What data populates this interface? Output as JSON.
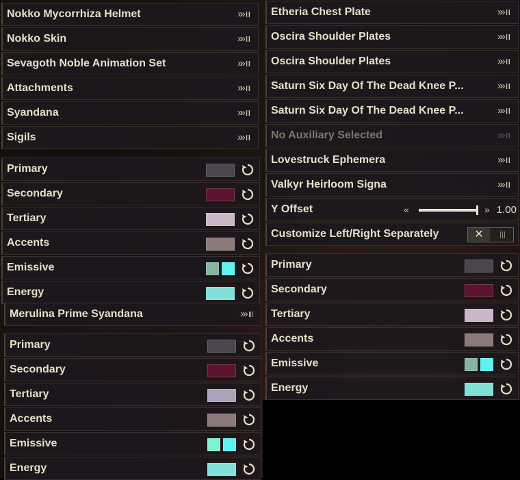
{
  "left": {
    "slots": [
      {
        "label": "Nokko Mycorrhiza Helmet",
        "icon": "chevron-double-right-icon"
      },
      {
        "label": "Nokko Skin",
        "icon": "chevron-double-right-icon"
      },
      {
        "label": "Sevagoth Noble Animation Set",
        "icon": "chevron-double-right-icon"
      },
      {
        "label": "Attachments",
        "icon": "chevron-double-right-icon"
      },
      {
        "label": "Syandana",
        "icon": "chevron-double-right-icon"
      },
      {
        "label": "Sigils",
        "icon": "chevron-double-right-icon"
      }
    ],
    "colors": [
      {
        "label": "Primary",
        "swatches": [
          "#4a4650"
        ]
      },
      {
        "label": "Secondary",
        "swatches": [
          "#5c1530"
        ]
      },
      {
        "label": "Tertiary",
        "swatches": [
          "#c9b6c7"
        ]
      },
      {
        "label": "Accents",
        "swatches": [
          "#8c7a7a"
        ]
      },
      {
        "label": "Emissive",
        "swatches": [
          "#86b5a2",
          "#5ff2f2"
        ]
      },
      {
        "label": "Energy",
        "swatches": [
          "#7fe0da"
        ]
      }
    ],
    "syandana": {
      "label": "Merulina Prime Syandana",
      "icon": "chevron-double-right-icon"
    },
    "syandana_colors": [
      {
        "label": "Primary",
        "swatches": [
          "#4a4650"
        ]
      },
      {
        "label": "Secondary",
        "swatches": [
          "#5c1530"
        ]
      },
      {
        "label": "Tertiary",
        "swatches": [
          "#a9a4ba"
        ]
      },
      {
        "label": "Accents",
        "swatches": [
          "#8c7a7a"
        ]
      },
      {
        "label": "Emissive",
        "swatches": [
          "#80f0d2",
          "#5ff2f2"
        ]
      },
      {
        "label": "Energy",
        "swatches": [
          "#7fe0da"
        ]
      }
    ]
  },
  "right": {
    "slots": [
      {
        "label": "Etheria Chest Plate",
        "disabled": false
      },
      {
        "label": "Oscira Shoulder Plates",
        "disabled": false
      },
      {
        "label": "Oscira Shoulder Plates",
        "disabled": false
      },
      {
        "label": "Saturn Six Day Of The Dead Knee P...",
        "disabled": false
      },
      {
        "label": "Saturn Six Day Of The Dead Knee P...",
        "disabled": false
      },
      {
        "label": "No Auxiliary Selected",
        "disabled": true
      },
      {
        "label": "Lovestruck Ephemera",
        "disabled": false
      },
      {
        "label": "Valkyr Heirloom Signa",
        "disabled": false
      }
    ],
    "y_offset": {
      "label": "Y Offset",
      "value": "1.00",
      "level": 1.0
    },
    "customize": {
      "label": "Customize Left/Right Separately",
      "state": "off"
    },
    "colors": [
      {
        "label": "Primary",
        "swatches": [
          "#4a4650"
        ]
      },
      {
        "label": "Secondary",
        "swatches": [
          "#5c1530"
        ]
      },
      {
        "label": "Tertiary",
        "swatches": [
          "#c9b6c7"
        ]
      },
      {
        "label": "Accents",
        "swatches": [
          "#8c7a7a"
        ]
      },
      {
        "label": "Emissive",
        "swatches": [
          "#86b5a2",
          "#5ff2f2"
        ]
      },
      {
        "label": "Energy",
        "swatches": [
          "#7fe0da"
        ]
      }
    ]
  },
  "theme": {
    "text": "#e9dfc8",
    "accent": "#cfc4ad",
    "row_bg": "#1c181e"
  }
}
